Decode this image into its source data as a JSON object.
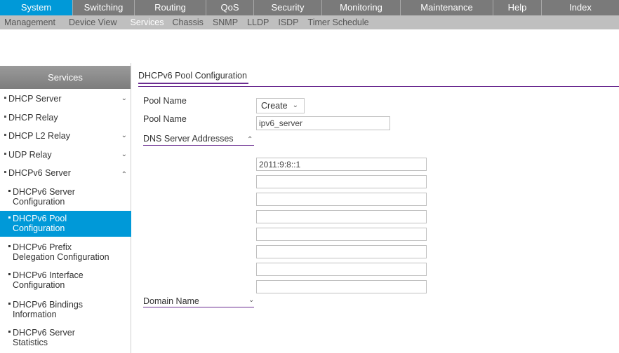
{
  "top_menu": [
    "System",
    "Switching",
    "Routing",
    "QoS",
    "Security",
    "Monitoring",
    "Maintenance",
    "Help",
    "Index"
  ],
  "sub_menu": [
    "Management",
    "Device View",
    "Services",
    "Chassis",
    "SNMP",
    "LLDP",
    "ISDP",
    "Timer Schedule"
  ],
  "sidebar": {
    "title": "Services",
    "items": [
      "DHCP Server",
      "DHCP Relay",
      "DHCP L2 Relay",
      "UDP Relay",
      "DHCPv6 Server"
    ],
    "sub_items": [
      [
        "DHCPv6 Server",
        "Configuration"
      ],
      [
        "DHCPv6 Pool",
        "Configuration"
      ],
      [
        "DHCPv6 Prefix",
        "Delegation Configuration"
      ],
      [
        "DHCPv6 Interface",
        "Configuration"
      ],
      [
        "DHCPv6 Bindings",
        "Information"
      ],
      [
        "DHCPv6 Server",
        "Statistics"
      ]
    ]
  },
  "main": {
    "tab": "DHCPv6 Pool Configuration",
    "pool_name_label_1": "Pool Name",
    "pool_name_select": "Create",
    "pool_name_label_2": "Pool Name",
    "pool_name_value": "ipv6_server",
    "dns_section": "DNS Server Addresses",
    "dns_values": [
      "2011:9:8::1",
      "",
      "",
      "",
      "",
      "",
      "",
      ""
    ],
    "domain_section": "Domain Name"
  },
  "colors": {
    "accent": "#0099d8",
    "menu_bg": "#7a7a7a",
    "submenu_bg": "#bfbfbf",
    "section_line": "#6b2c91"
  }
}
